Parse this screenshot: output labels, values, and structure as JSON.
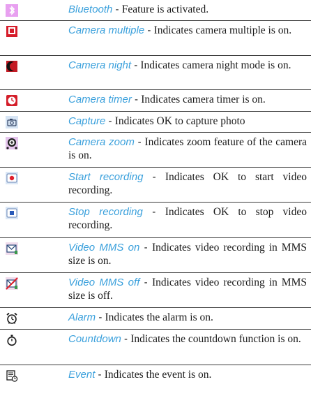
{
  "colors": {
    "term": "#3aa0dc",
    "text": "#1a1a1a",
    "rule": "#3c3c3c"
  },
  "items": [
    {
      "icon": "bluetooth-icon",
      "term": "Bluetooth",
      "sep": " - ",
      "desc": "Feature is activated."
    },
    {
      "icon": "camera-multiple-icon",
      "term": "Camera multiple",
      "sep": " - ",
      "desc": "Indicates camera multiple is on."
    },
    {
      "icon": "camera-night-icon",
      "term": "Camera night",
      "sep": " - ",
      "desc": "Indicates camera night mode is on."
    },
    {
      "icon": "camera-timer-icon",
      "term": "Camera timer",
      "sep": " - ",
      "desc": "Indicates camera timer is on."
    },
    {
      "icon": "capture-icon",
      "term": "Capture",
      "sep": " - ",
      "desc": "Indicates OK to capture photo"
    },
    {
      "icon": "camera-zoom-icon",
      "term": "Camera zoom",
      "sep": " - ",
      "desc": "Indicates zoom feature of the camera is on."
    },
    {
      "icon": "start-recording-icon",
      "term": "Start recording",
      "sep": " - ",
      "desc": "Indicates OK to start video recording."
    },
    {
      "icon": "stop-recording-icon",
      "term": "Stop recording",
      "sep": " - ",
      "desc": "Indicates OK to stop video recording."
    },
    {
      "icon": "video-mms-on-icon",
      "term": "Video MMS on",
      "sep": " - ",
      "desc": "Indicates video recording in MMS size is on."
    },
    {
      "icon": "video-mms-off-icon",
      "term": "Video MMS off",
      "sep": " - ",
      "desc": "Indicates video recording in MMS size is off."
    },
    {
      "icon": "alarm-icon",
      "term": "Alarm",
      "sep": " - ",
      "desc": "Indicates the alarm is on."
    },
    {
      "icon": "countdown-icon",
      "term": "Countdown",
      "sep": " - ",
      "desc": "Indicates the countdown function is on."
    },
    {
      "icon": "event-icon",
      "term": "Event",
      "sep": " - ",
      "desc": "Indicates the event is on."
    }
  ]
}
